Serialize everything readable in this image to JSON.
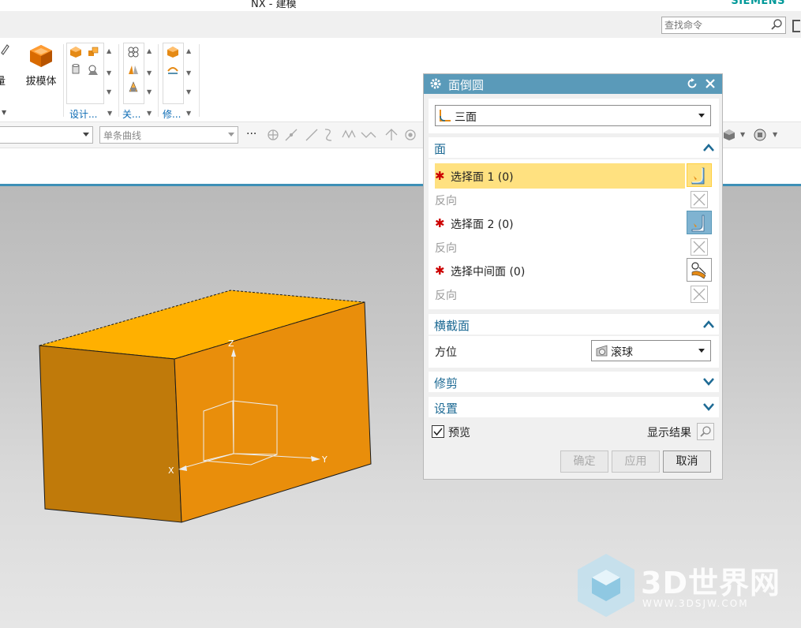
{
  "window": {
    "title": "NX - 建模",
    "brand": "SIEMENS"
  },
  "command_search": {
    "placeholder": "查找命令"
  },
  "ribbon": {
    "partial_label": "量",
    "draft_body_label": "拔模体",
    "groups": [
      {
        "label": "设计..."
      },
      {
        "label": "关..."
      },
      {
        "label": "修..."
      }
    ]
  },
  "toolbar": {
    "curve_rule_placeholder": "单条曲线",
    "more": "···"
  },
  "dialog": {
    "title": "面倒圆",
    "type_value": "三面",
    "sections": {
      "face": {
        "title": "面",
        "select_face1": "选择面 1 (0)",
        "reverse1": "反向",
        "select_face2": "选择面 2 (0)",
        "reverse2": "反向",
        "select_middle": "选择中间面 (0)",
        "reverse3": "反向",
        "required_mark": "✱"
      },
      "cross_section": {
        "title": "横截面",
        "orientation_label": "方位",
        "orientation_value": "滚球"
      },
      "trim": {
        "title": "修剪"
      },
      "settings": {
        "title": "设置"
      }
    },
    "preview_label": "预览",
    "preview_checked": true,
    "show_result_label": "显示结果",
    "ok_label": "确定",
    "apply_label": "应用",
    "cancel_label": "取消"
  },
  "triad": {
    "x": "X",
    "y": "Y",
    "z": "Z"
  },
  "watermark": {
    "brand": "3D世界网",
    "url": "WWW.3DSJW.COM"
  },
  "colors": {
    "accent": "#5a9ab9",
    "highlight_row": "#ffe180",
    "section_title": "#1d6a94",
    "block_front": "#c07a0a",
    "block_side": "#e98e0b",
    "block_top": "#ffb000"
  }
}
